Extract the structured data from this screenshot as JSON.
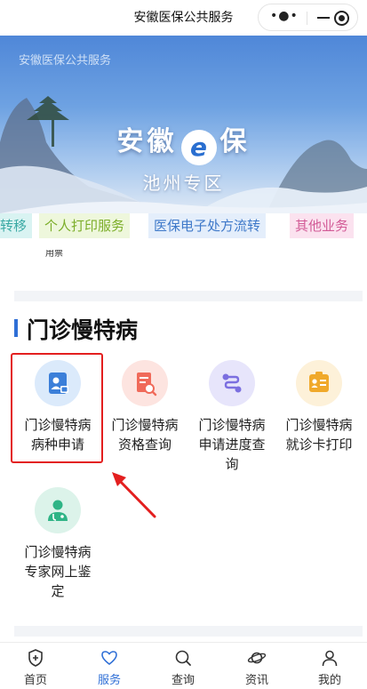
{
  "topbar": {
    "title": "安徽医保公共服务",
    "more_label": "•●•"
  },
  "banner": {
    "subtitle": "安徽医保公共服务",
    "title_left": "安徽",
    "title_mark": "e",
    "title_right": "保",
    "region": "池州专区"
  },
  "tabs": [
    {
      "label": "转移",
      "color": "#3aa9a4"
    },
    {
      "label": "个人打印服务",
      "color": "#7cae2a"
    },
    {
      "label": "医保电子处方流转",
      "color": "#3f79c9"
    },
    {
      "label": "其他业务",
      "color": "#d25a96"
    }
  ],
  "partial_text": "用票",
  "section": {
    "title": "门诊慢特病",
    "accent": "#2f6fd6",
    "items": [
      {
        "label_line1": "门诊慢特病",
        "label_line2": "病种申请",
        "label_line3": "",
        "icon": "id-card-lock-icon",
        "bg": "#dbeafb",
        "fg": "#3b7fd9"
      },
      {
        "label_line1": "门诊慢特病",
        "label_line2": "资格查询",
        "label_line3": "",
        "icon": "document-search-icon",
        "bg": "#fde4e0",
        "fg": "#f06a5a"
      },
      {
        "label_line1": "门诊慢特病",
        "label_line2": "申请进度查",
        "label_line3": "询",
        "icon": "progress-flow-icon",
        "bg": "#e7e5fb",
        "fg": "#7b6fe0"
      },
      {
        "label_line1": "门诊慢特病",
        "label_line2": "就诊卡打印",
        "label_line3": "",
        "icon": "badge-card-icon",
        "bg": "#fdf1d9",
        "fg": "#f0a92b"
      },
      {
        "label_line1": "门诊慢特病",
        "label_line2": "专家网上鉴",
        "label_line3": "定",
        "icon": "doctor-icon",
        "bg": "#dcf3ea",
        "fg": "#2fb486"
      }
    ]
  },
  "bottom_nav": [
    {
      "label": "首页",
      "icon": "shield-home-icon",
      "active": false
    },
    {
      "label": "服务",
      "icon": "heart-icon",
      "active": true
    },
    {
      "label": "查询",
      "icon": "search-icon",
      "active": false
    },
    {
      "label": "资讯",
      "icon": "planet-icon",
      "active": false
    },
    {
      "label": "我的",
      "icon": "person-icon",
      "active": false
    }
  ],
  "annotation_color": "#e31f1f"
}
